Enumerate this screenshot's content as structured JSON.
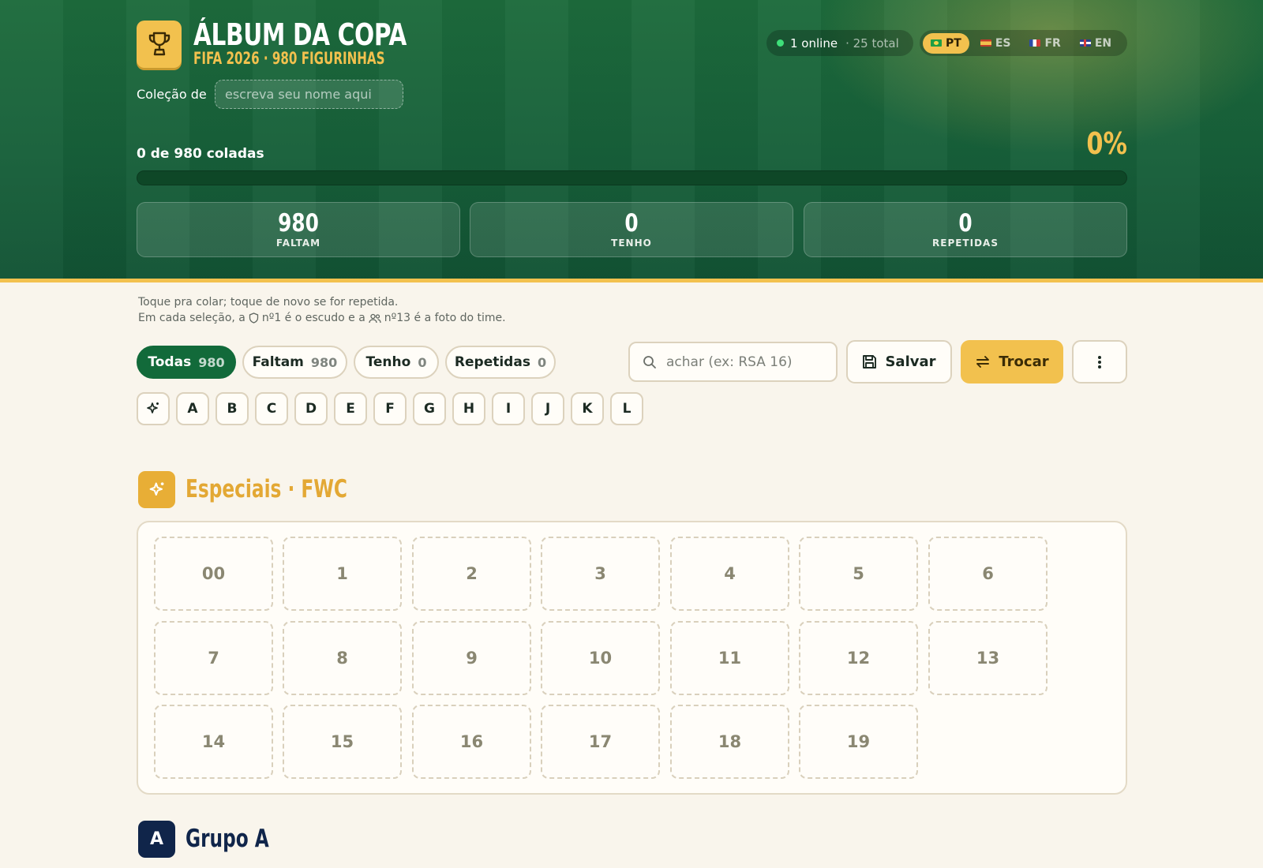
{
  "header": {
    "title": "ÁLBUM DA COPA",
    "subtitle": "FIFA 2026 · 980 FIGURINHAS",
    "collection_label": "Coleção de",
    "name_placeholder": "escreva seu nome aqui",
    "online_count": "1 online",
    "online_total": "· 25 total",
    "languages": [
      {
        "code": "PT",
        "active": true
      },
      {
        "code": "ES",
        "active": false
      },
      {
        "code": "FR",
        "active": false
      },
      {
        "code": "EN",
        "active": false
      }
    ],
    "progress_label": "0 de 980 coladas",
    "progress_percent_text": "0%",
    "progress_fraction": 0,
    "stats": [
      {
        "value": "980",
        "label": "FALTAM"
      },
      {
        "value": "0",
        "label": "TENHO"
      },
      {
        "value": "0",
        "label": "REPETIDAS"
      }
    ]
  },
  "hints": {
    "line1": "Toque pra colar; toque de novo se for repetida.",
    "line2_a": "Em cada seleção, a",
    "line2_b": "nº1 é o escudo e a",
    "line2_c": "nº13 é a foto do time."
  },
  "filters": [
    {
      "label": "Todas",
      "count": "980",
      "active": true
    },
    {
      "label": "Faltam",
      "count": "980",
      "active": false
    },
    {
      "label": "Tenho",
      "count": "0",
      "active": false
    },
    {
      "label": "Repetidas",
      "count": "0",
      "active": false
    }
  ],
  "search": {
    "placeholder": "achar (ex: RSA 16)"
  },
  "actions": {
    "save": "Salvar",
    "trade": "Trocar"
  },
  "group_letters": [
    "A",
    "B",
    "C",
    "D",
    "E",
    "F",
    "G",
    "H",
    "I",
    "J",
    "K",
    "L"
  ],
  "sections": [
    {
      "title": "Especiais · FWC",
      "stickers": [
        "00",
        "1",
        "2",
        "3",
        "4",
        "5",
        "6",
        "7",
        "8",
        "9",
        "10",
        "11",
        "12",
        "13",
        "14",
        "15",
        "16",
        "17",
        "18",
        "19"
      ]
    },
    {
      "badge": "A",
      "title": "Grupo A"
    }
  ],
  "colors": {
    "green": "#126a3a",
    "gold": "#f2c14e",
    "navy": "#10254a"
  }
}
